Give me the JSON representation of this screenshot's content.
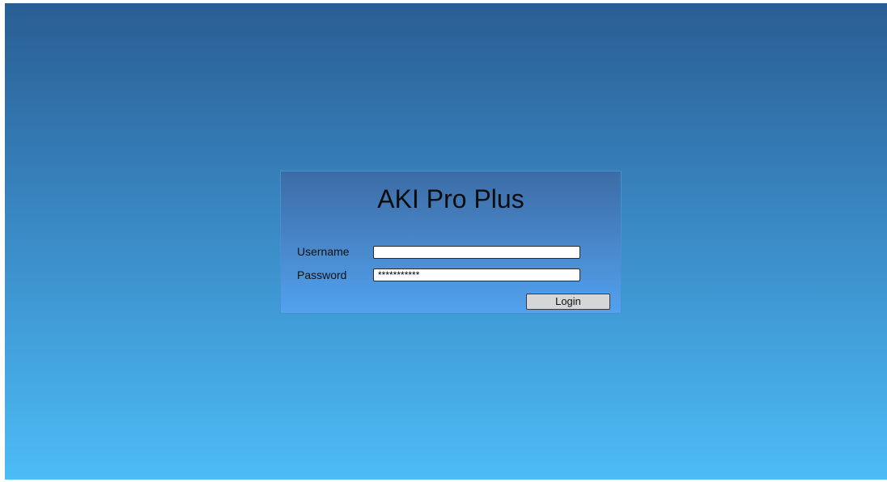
{
  "login": {
    "app_title": "AKI Pro Plus",
    "username_label": "Username",
    "username_value": "",
    "password_label": "Password",
    "password_value": "***********",
    "login_button_label": "Login"
  },
  "colors": {
    "background_top": "#295e93",
    "background_bottom": "#4dbcf5",
    "panel_top": "#3c6ca6",
    "panel_bottom": "#52a2f0",
    "button_fill": "#d6d6d6"
  }
}
